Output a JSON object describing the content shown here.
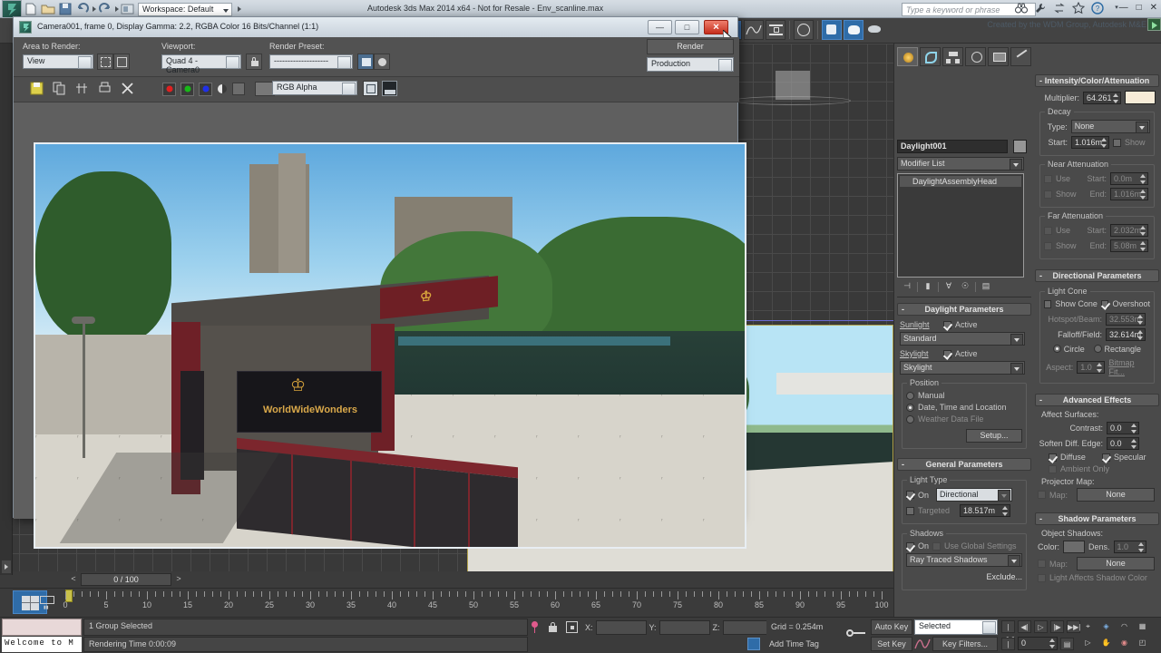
{
  "app": {
    "title": "Autodesk 3ds Max  2014 x64  - Not for Resale - Env_scanline.max",
    "credit": "Created by the WDM Group, Autodesk M&E",
    "workspace_label": "Workspace: Default",
    "search_placeholder": "Type a keyword or phrase",
    "window_buttons": {
      "minimize": "—",
      "maximize": "□",
      "close": "✕"
    }
  },
  "render_window": {
    "title": "Camera001, frame 0, Display Gamma: 2.2, RGBA Color 16 Bits/Channel (1:1)",
    "titlebar_buttons": {
      "minimize": "—",
      "maximize": "□",
      "close": "✕"
    },
    "area_to_render_label": "Area to Render:",
    "area_to_render_value": "View",
    "viewport_label": "Viewport:",
    "viewport_value": "Quad 4 - Camera0",
    "render_preset_label": "Render Preset:",
    "render_preset_value": "--------------------",
    "render_button": "Render",
    "render_mode": "Production",
    "channel_value": "RGB Alpha",
    "toolbar_icons": [
      "save-icon",
      "clone-icon",
      "compare-icon",
      "print-icon",
      "clear-icon"
    ],
    "channel_buttons": [
      "red-channel",
      "green-channel",
      "blue-channel",
      "alpha-channel",
      "mono-channel"
    ],
    "rendered_scene": {
      "kiosk_sign_text": "WorldWideWonders",
      "kiosk_logo": "crown-logo"
    }
  },
  "command_panel": {
    "tabs": [
      "create-tab",
      "modify-tab",
      "hierarchy-tab",
      "motion-tab",
      "display-tab",
      "utilities-tab"
    ],
    "object_name": "Daylight001",
    "modifier_list_label": "Modifier List",
    "modifier_stack": [
      "DaylightAssemblyHead"
    ],
    "stack_buttons": [
      "pin-stack",
      "show-end-result",
      "make-unique",
      "remove-modifier",
      "configure-sets"
    ],
    "daylight_parameters": {
      "header": "Daylight Parameters",
      "sunlight_label": "Sunlight",
      "sunlight_active_label": "Active",
      "sunlight_active": true,
      "sunlight_type": "Standard",
      "skylight_label": "Skylight",
      "skylight_active_label": "Active",
      "skylight_active": true,
      "skylight_type": "Skylight",
      "position_group": "Position",
      "position_options": [
        "Manual",
        "Date, Time and Location",
        "Weather Data File"
      ],
      "position_selected": "Date, Time and Location",
      "setup_button": "Setup..."
    },
    "general_parameters": {
      "header": "General Parameters",
      "light_type_group": "Light Type",
      "on_label": "On",
      "on": true,
      "light_type": "Directional",
      "targeted_label": "Targeted",
      "targeted": false,
      "target_distance": "18.517m",
      "shadows_group": "Shadows",
      "shadows_on_label": "On",
      "shadows_on": true,
      "use_global_label": "Use Global Settings",
      "use_global": false,
      "shadow_type": "Ray Traced Shadows",
      "exclude_button": "Exclude..."
    },
    "intensity": {
      "header": "Intensity/Color/Attenuation",
      "multiplier_label": "Multiplier:",
      "multiplier": "64.261",
      "color_swatch": "#f7ecd8",
      "decay_group": "Decay",
      "decay_type_label": "Type:",
      "decay_type": "None",
      "decay_start_label": "Start:",
      "decay_start": "1.016m",
      "decay_show_label": "Show",
      "near_group": "Near Attenuation",
      "near_use_label": "Use",
      "near_show_label": "Show",
      "near_start_label": "Start:",
      "near_start": "0.0m",
      "near_end_label": "End:",
      "near_end": "1.016m",
      "far_group": "Far Attenuation",
      "far_use_label": "Use",
      "far_show_label": "Show",
      "far_start_label": "Start:",
      "far_start": "2.032m",
      "far_end_label": "End:",
      "far_end": "5.08m"
    },
    "directional": {
      "header": "Directional Parameters",
      "light_cone_group": "Light Cone",
      "show_cone_label": "Show Cone",
      "show_cone": false,
      "overshoot_label": "Overshoot",
      "overshoot": true,
      "hotspot_label": "Hotspot/Beam:",
      "hotspot": "32.553m",
      "falloff_label": "Falloff/Field:",
      "falloff": "32.614m",
      "shape_options": [
        "Circle",
        "Rectangle"
      ],
      "shape_selected": "Circle",
      "aspect_label": "Aspect:",
      "aspect": "1.0",
      "bitmap_fit_button": "Bitmap Fit..."
    },
    "advanced_effects": {
      "header": "Advanced Effects",
      "affect_surfaces_group": "Affect Surfaces:",
      "contrast_label": "Contrast:",
      "contrast": "0.0",
      "soften_label": "Soften Diff. Edge:",
      "soften": "0.0",
      "diffuse_label": "Diffuse",
      "diffuse": true,
      "specular_label": "Specular",
      "specular": true,
      "ambient_only_label": "Ambient Only",
      "ambient_only": false,
      "projector_map_group": "Projector Map:",
      "map_label": "Map:",
      "map_value": "None"
    },
    "shadow_parameters": {
      "header": "Shadow Parameters",
      "object_shadows_group": "Object Shadows:",
      "color_label": "Color:",
      "dens_label": "Dens.",
      "dens": "1.0",
      "map_label": "Map:",
      "map_value": "None",
      "light_affects_label": "Light Affects Shadow Color"
    }
  },
  "timeline": {
    "frame_field": "0 / 100",
    "prev_arrow": "<",
    "next_arrow": ">",
    "ruler_ticks": [
      0,
      5,
      10,
      15,
      20,
      25,
      30,
      35,
      40,
      45,
      50,
      55,
      60,
      65,
      70,
      75,
      80,
      85,
      90,
      95,
      100
    ]
  },
  "status_bar": {
    "prompt_line": "Welcome to M",
    "selection_status": "1 Group Selected",
    "rendering_time": "Rendering Time  0:00:09",
    "x_label": "X:",
    "y_label": "Y:",
    "z_label": "Z:",
    "x_value": "",
    "y_value": "",
    "z_value": "",
    "grid_label": "Grid = 0.254m",
    "add_time_tag": "Add Time Tag",
    "auto_key": "Auto Key",
    "set_key": "Set Key",
    "key_mode": "Selected",
    "key_filters": "Key Filters...",
    "current_frame": "0"
  }
}
